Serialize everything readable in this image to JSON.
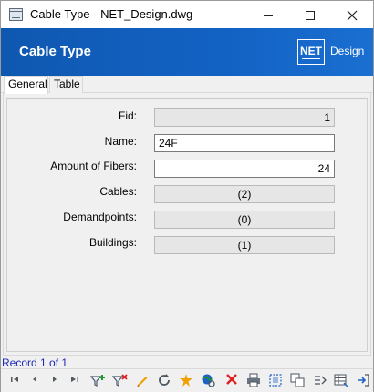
{
  "window": {
    "title": "Cable Type - NET_Design.dwg"
  },
  "banner": {
    "title": "Cable Type",
    "brand_box": "NET",
    "brand_text": "Design"
  },
  "tabs": [
    {
      "label": "General"
    },
    {
      "label": "Table"
    }
  ],
  "fields": {
    "fid": {
      "label": "Fid:",
      "value": "1"
    },
    "name": {
      "label": "Name:",
      "value": "24F"
    },
    "fibers": {
      "label": "Amount of Fibers:",
      "value": "24"
    },
    "cables": {
      "label": "Cables:",
      "value": "(2)"
    },
    "demandpoints": {
      "label": "Demandpoints:",
      "value": "(0)"
    },
    "buildings": {
      "label": "Buildings:",
      "value": "(1)"
    }
  },
  "status": {
    "record": "Record 1 of 1"
  },
  "toolbar": {
    "icons": [
      "first-icon",
      "previous-icon",
      "next-icon",
      "last-icon",
      "add-filter-icon",
      "remove-filter-icon",
      "edit-icon",
      "refresh-icon",
      "highlight-icon",
      "zoom-globe-icon",
      "delete-icon",
      "print-icon",
      "select-icon",
      "copy-icon",
      "move-icon",
      "table-icon",
      "exit-icon"
    ],
    "accent_red": "#e02020",
    "accent_green": "#1a9a2a",
    "accent_blue": "#2060c0",
    "accent_yellow": "#f0a000"
  },
  "colors": {
    "banner": "#1262c4",
    "record_text": "#1d2ab8"
  }
}
